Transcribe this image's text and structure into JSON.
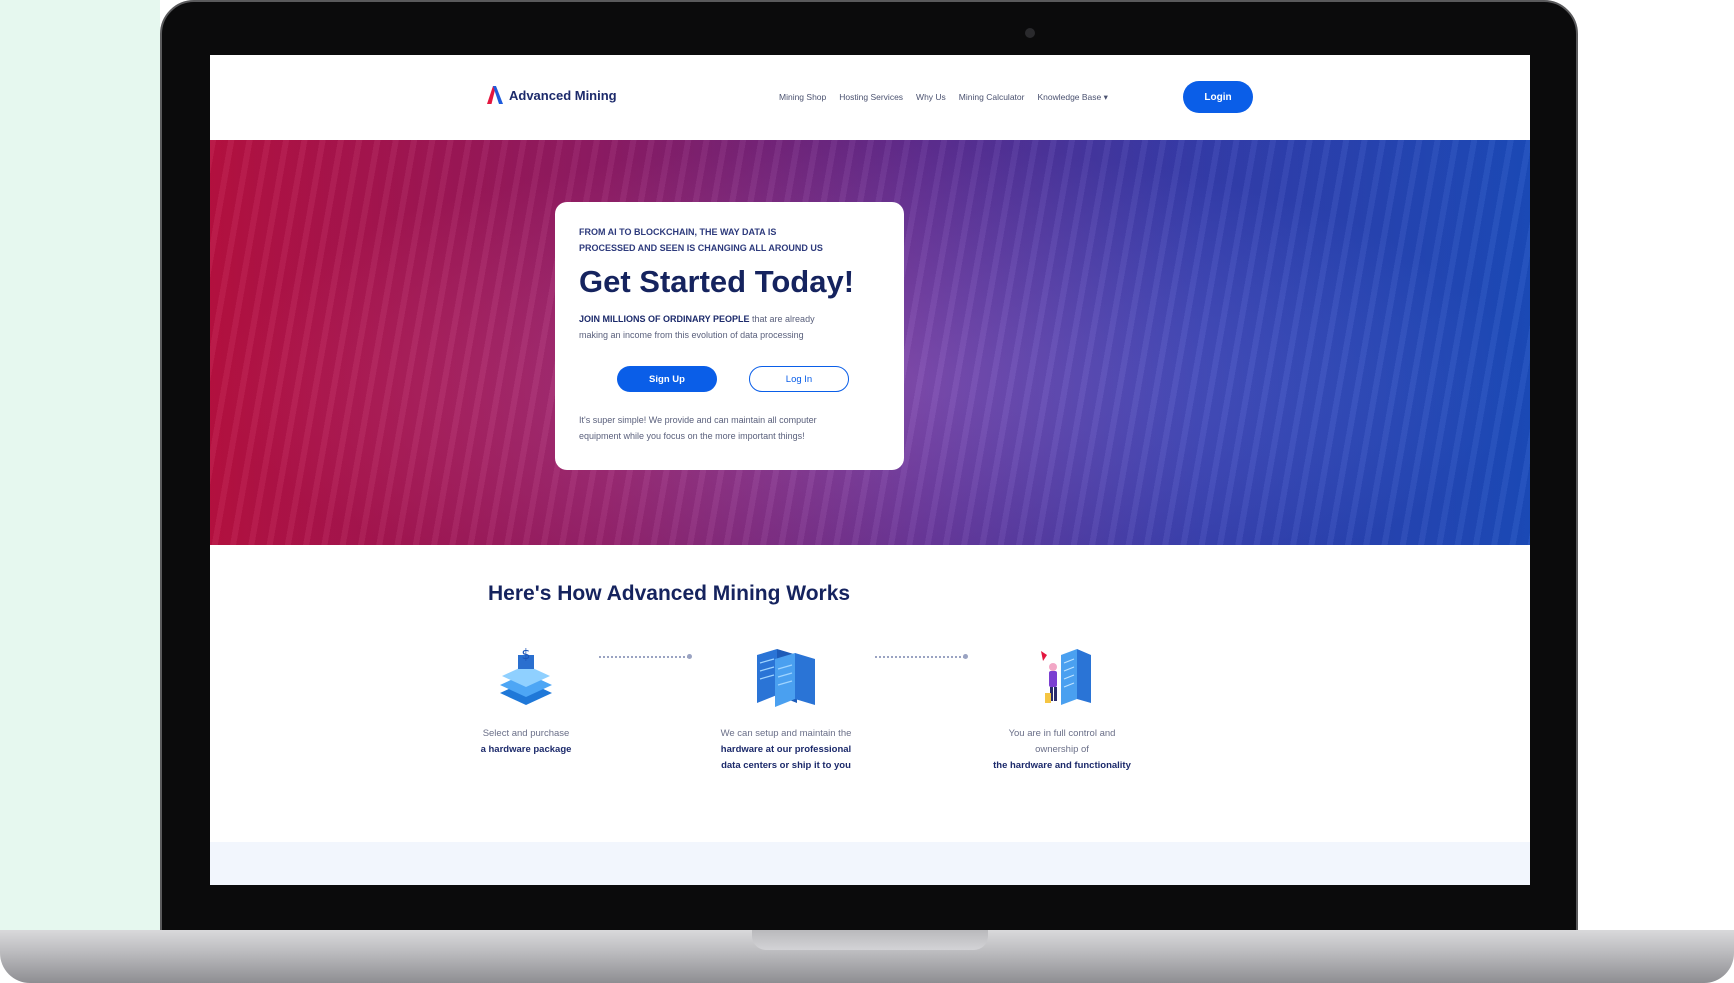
{
  "brand": {
    "name": "Advanced Mining",
    "colors": {
      "accent": "#0a5ee8",
      "navy": "#15235e",
      "mint": "#e6f8ef",
      "hero_start": "#d2134a",
      "hero_end": "#1f56d6"
    }
  },
  "nav": {
    "links": [
      "Mining Shop",
      "Hosting Services",
      "Why Us",
      "Mining Calculator",
      "Knowledge Base"
    ],
    "dropdown_icon": "caret-down-icon",
    "login_label": "Login"
  },
  "hero": {
    "kicker_line1": "FROM AI TO BLOCKCHAIN, THE WAY DATA IS",
    "kicker_line2": "PROCESSED AND SEEN IS CHANGING ALL AROUND US",
    "title": "Get Started Today!",
    "body_bold": "JOIN MILLIONS OF ORDINARY PEOPLE",
    "body_rest_line1": " that are already",
    "body_line2": "making an income from this evolution of data processing",
    "signup_label": "Sign Up",
    "login_label": "Log In",
    "foot_line1": "It's super simple! We provide and can maintain all computer",
    "foot_line2": "equipment while you focus on the more important things!"
  },
  "how": {
    "title": "Here's How Advanced Mining Works",
    "steps": [
      {
        "icon": "hardware-stack-icon",
        "line1": "Select and purchase",
        "bold1": "a hardware package",
        "bold2": ""
      },
      {
        "icon": "server-rack-icon",
        "line1": "We can setup and maintain the",
        "bold1": "hardware at our professional",
        "bold2": "data centers or ship it to you"
      },
      {
        "icon": "user-server-icon",
        "line1": "You are in full control and",
        "line2": "ownership of",
        "bold1": "the hardware and functionality"
      }
    ]
  }
}
